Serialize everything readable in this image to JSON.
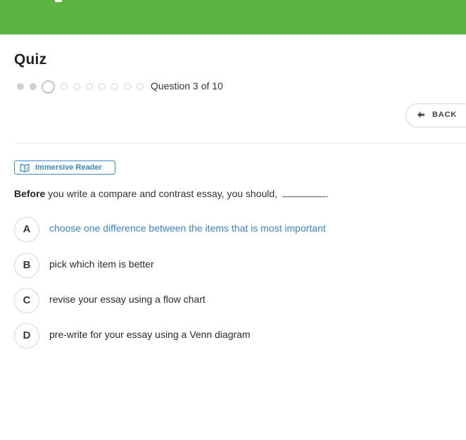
{
  "quiz": {
    "title": "Quiz",
    "progress": {
      "current": 3,
      "total": 10,
      "text": "Question 3 of 10"
    }
  },
  "toolbar": {
    "back_label": "BACK",
    "back_icon": "arrow-left-icon"
  },
  "immersive_reader": {
    "label": "Immersive Reader",
    "icon": "immersive-reader-icon"
  },
  "question": {
    "lead": "Before",
    "text": " you write a compare and contrast essay, you should, ",
    "trailing": "."
  },
  "choices": [
    {
      "letter": "A",
      "text": "choose one difference between the items that is most important",
      "selected": true
    },
    {
      "letter": "B",
      "text": "pick which item is better",
      "selected": false
    },
    {
      "letter": "C",
      "text": "revise your essay using a flow chart",
      "selected": false
    },
    {
      "letter": "D",
      "text": "pre-write for your essay using a Venn diagram",
      "selected": false
    }
  ],
  "colors": {
    "banner": "#5cb442",
    "accent": "#3a86c8"
  }
}
